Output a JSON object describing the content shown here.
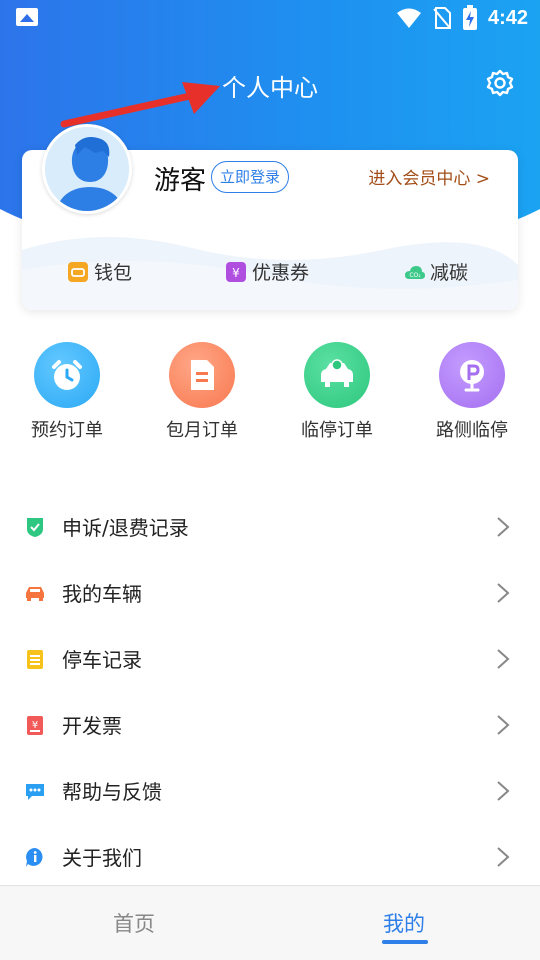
{
  "status_bar": {
    "time": "4:42"
  },
  "header": {
    "title": "个人中心"
  },
  "profile": {
    "name": "游客",
    "login_button": "立即登录",
    "member_link": "进入会员中心 >",
    "quick_links": [
      {
        "label": "钱包",
        "icon": "wallet-icon",
        "color": "#f5a623"
      },
      {
        "label": "优惠券",
        "icon": "coupon-icon",
        "color": "#b04ee0"
      },
      {
        "label": "减碳",
        "icon": "co2-cloud-icon",
        "color": "#3cc98a"
      }
    ]
  },
  "orders": [
    {
      "label": "预约订单",
      "icon": "alarm-clock-icon",
      "color": "#2ba9f5"
    },
    {
      "label": "包月订单",
      "icon": "document-icon",
      "color": "#f8784f"
    },
    {
      "label": "临停订单",
      "icon": "car-icon",
      "color": "#2dc77d"
    },
    {
      "label": "路侧临停",
      "icon": "parking-pin-icon",
      "color": "#a56ff0"
    }
  ],
  "menu": [
    {
      "label": "申诉/退费记录",
      "icon": "shield-check-icon",
      "color": "#2ec782"
    },
    {
      "label": "我的车辆",
      "icon": "car-front-icon",
      "color": "#f6743e"
    },
    {
      "label": "停车记录",
      "icon": "notepad-icon",
      "color": "#f8c21c"
    },
    {
      "label": "开发票",
      "icon": "invoice-icon",
      "color": "#f25a5a"
    },
    {
      "label": "帮助与反馈",
      "icon": "chat-bubble-icon",
      "color": "#2ba0f3"
    },
    {
      "label": "关于我们",
      "icon": "info-icon",
      "color": "#2b8ef3"
    }
  ],
  "tabs": {
    "home": "首页",
    "mine": "我的"
  },
  "colors": {
    "accent": "#2e7fe8",
    "header_start": "#2f6fe9",
    "header_end": "#1aa8f3",
    "member_link": "#a34d17"
  }
}
